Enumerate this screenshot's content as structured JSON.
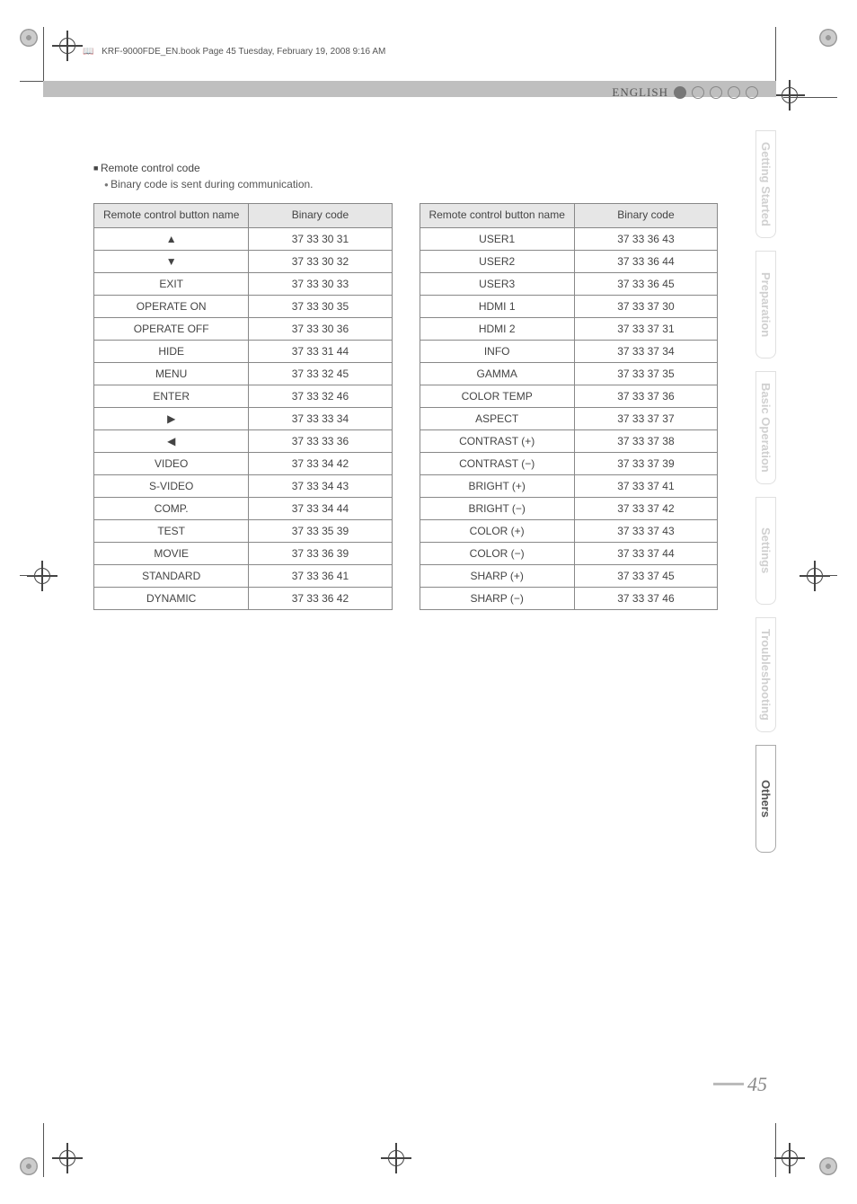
{
  "header_meta": "KRF-9000FDE_EN.book  Page 45  Tuesday, February 19, 2008  9:16 AM",
  "language": "ENGLISH",
  "page_number": "45",
  "side_tabs": [
    {
      "label": "Getting Started",
      "active": false
    },
    {
      "label": "Preparation",
      "active": false
    },
    {
      "label": "Basic Operation",
      "active": false
    },
    {
      "label": "Settings",
      "active": false
    },
    {
      "label": "Troubleshooting",
      "active": false
    },
    {
      "label": "Others",
      "active": true
    }
  ],
  "section": {
    "title": "Remote control code",
    "note": "Binary code is sent during communication.",
    "col_header_button": "Remote control button name",
    "col_header_code": "Binary code"
  },
  "table_left": [
    {
      "button": "▲",
      "code": "37 33 30 31"
    },
    {
      "button": "▼",
      "code": "37 33 30 32"
    },
    {
      "button": "EXIT",
      "code": "37 33 30 33"
    },
    {
      "button": "OPERATE ON",
      "code": "37 33 30 35"
    },
    {
      "button": "OPERATE OFF",
      "code": "37 33 30 36"
    },
    {
      "button": "HIDE",
      "code": "37 33 31 44"
    },
    {
      "button": "MENU",
      "code": "37 33 32 45"
    },
    {
      "button": "ENTER",
      "code": "37 33 32 46"
    },
    {
      "button": "▶",
      "code": "37 33 33 34"
    },
    {
      "button": "◀",
      "code": "37 33 33 36"
    },
    {
      "button": "VIDEO",
      "code": "37 33 34 42"
    },
    {
      "button": "S-VIDEO",
      "code": "37 33 34 43"
    },
    {
      "button": "COMP.",
      "code": "37 33 34 44"
    },
    {
      "button": "TEST",
      "code": "37 33 35 39"
    },
    {
      "button": "MOVIE",
      "code": "37 33 36 39"
    },
    {
      "button": "STANDARD",
      "code": "37 33 36 41"
    },
    {
      "button": "DYNAMIC",
      "code": "37 33 36 42"
    }
  ],
  "table_right": [
    {
      "button": "USER1",
      "code": "37 33 36 43"
    },
    {
      "button": "USER2",
      "code": "37 33 36 44"
    },
    {
      "button": "USER3",
      "code": "37 33 36 45"
    },
    {
      "button": "HDMI 1",
      "code": "37 33 37 30"
    },
    {
      "button": "HDMI 2",
      "code": "37 33 37 31"
    },
    {
      "button": "INFO",
      "code": "37 33 37 34"
    },
    {
      "button": "GAMMA",
      "code": "37 33 37 35"
    },
    {
      "button": "COLOR TEMP",
      "code": "37 33 37 36"
    },
    {
      "button": "ASPECT",
      "code": "37 33 37 37"
    },
    {
      "button": "CONTRAST (+)",
      "code": "37 33 37 38"
    },
    {
      "button": "CONTRAST (−)",
      "code": "37 33 37 39"
    },
    {
      "button": "BRIGHT (+)",
      "code": "37 33 37 41"
    },
    {
      "button": "BRIGHT (−)",
      "code": "37 33 37 42"
    },
    {
      "button": "COLOR (+)",
      "code": "37 33 37 43"
    },
    {
      "button": "COLOR (−)",
      "code": "37 33 37 44"
    },
    {
      "button": "SHARP (+)",
      "code": "37 33 37 45"
    },
    {
      "button": "SHARP (−)",
      "code": "37 33 37 46"
    }
  ]
}
